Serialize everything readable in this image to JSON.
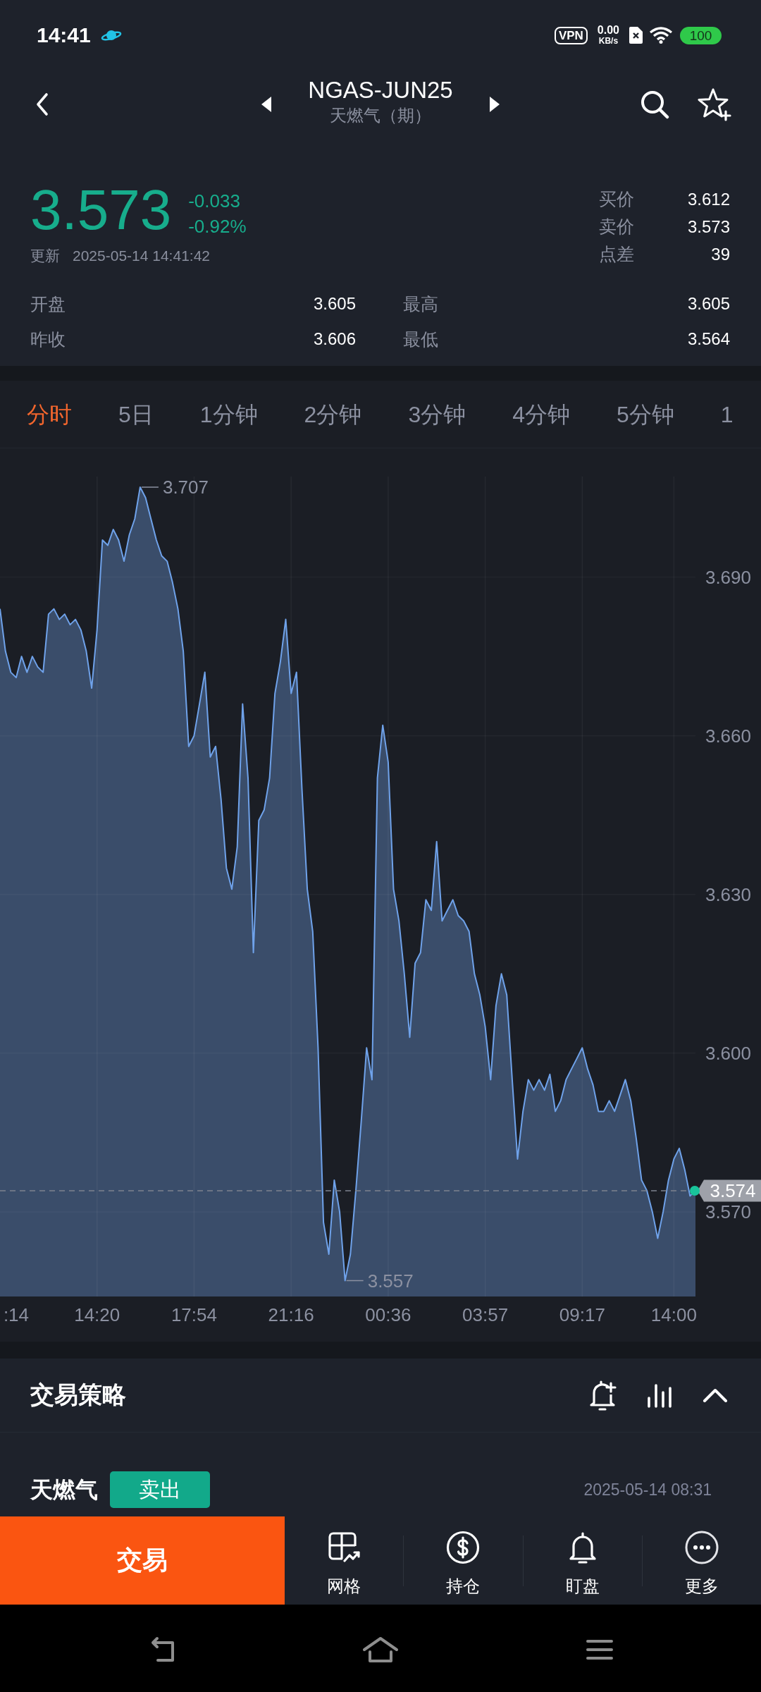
{
  "status_bar": {
    "time": "14:41",
    "vpn": "VPN",
    "net_speed": "0.00",
    "net_unit": "KB/s",
    "battery": "100"
  },
  "header": {
    "title": "NGAS-JUN25",
    "subtitle": "天燃气（期）"
  },
  "quote": {
    "price": "3.573",
    "change": "-0.033",
    "change_percent": "-0.92%",
    "down": true,
    "update_label": "更新",
    "update_time": "2025-05-14 14:41:42",
    "bid_ask": [
      {
        "label": "买价",
        "value": "3.612"
      },
      {
        "label": "卖价",
        "value": "3.573"
      },
      {
        "label": "点差",
        "value": "39"
      }
    ],
    "stats": [
      {
        "label": "开盘",
        "value": "3.605"
      },
      {
        "label": "最高",
        "value": "3.605"
      },
      {
        "label": "昨收",
        "value": "3.606"
      },
      {
        "label": "最低",
        "value": "3.564"
      }
    ]
  },
  "period_tabs": [
    {
      "label": "分时",
      "selected": true
    },
    {
      "label": "5日",
      "selected": false
    },
    {
      "label": "1分钟",
      "selected": false
    },
    {
      "label": "2分钟",
      "selected": false
    },
    {
      "label": "3分钟",
      "selected": false
    },
    {
      "label": "4分钟",
      "selected": false
    },
    {
      "label": "5分钟",
      "selected": false
    },
    {
      "label": "1",
      "selected": false
    }
  ],
  "chart": {
    "chart_data": {
      "type": "area",
      "categories": [
        null,
        null,
        null,
        ":14",
        null,
        null,
        null,
        null,
        null,
        null,
        null,
        null,
        null,
        null,
        null,
        null,
        null,
        null,
        "14:20",
        null,
        null,
        null,
        null,
        null,
        null,
        null,
        null,
        null,
        null,
        null,
        null,
        null,
        null,
        null,
        null,
        null,
        "17:54",
        null,
        null,
        null,
        null,
        null,
        null,
        null,
        null,
        null,
        null,
        null,
        null,
        null,
        null,
        null,
        null,
        null,
        "21:16",
        null,
        null,
        null,
        null,
        null,
        null,
        null,
        null,
        null,
        null,
        null,
        null,
        null,
        null,
        null,
        null,
        null,
        "00:36",
        null,
        null,
        null,
        null,
        null,
        null,
        null,
        null,
        null,
        null,
        null,
        null,
        null,
        null,
        null,
        null,
        null,
        "03:57",
        null,
        null,
        null,
        null,
        null,
        null,
        null,
        null,
        null,
        null,
        null,
        null,
        null,
        null,
        null,
        null,
        null,
        "09:17",
        null,
        null,
        null,
        null,
        null,
        null,
        null,
        null,
        null,
        null,
        null,
        null,
        null,
        null,
        null,
        null,
        "14:00",
        null,
        null,
        null,
        null
      ],
      "series": [
        {
          "color": "#6fa2ea",
          "values": [
            3.684,
            3.676,
            3.672,
            3.671,
            3.675,
            3.672,
            3.675,
            3.673,
            3.672,
            3.683,
            3.684,
            3.682,
            3.683,
            3.681,
            3.682,
            3.68,
            3.676,
            3.669,
            3.68,
            3.697,
            3.696,
            3.699,
            3.697,
            3.693,
            3.698,
            3.701,
            3.707,
            3.705,
            3.701,
            3.697,
            3.694,
            3.693,
            3.689,
            3.684,
            3.676,
            3.658,
            3.66,
            3.666,
            3.672,
            3.656,
            3.658,
            3.648,
            3.635,
            3.631,
            3.639,
            3.666,
            3.652,
            3.619,
            3.644,
            3.646,
            3.652,
            3.668,
            3.674,
            3.682,
            3.668,
            3.672,
            3.65,
            3.631,
            3.623,
            3.601,
            3.568,
            3.562,
            3.576,
            3.57,
            3.557,
            3.562,
            3.574,
            3.587,
            3.601,
            3.595,
            3.652,
            3.662,
            3.655,
            3.631,
            3.625,
            3.615,
            3.603,
            3.617,
            3.619,
            3.629,
            3.627,
            3.64,
            3.625,
            3.627,
            3.629,
            3.626,
            3.625,
            3.623,
            3.615,
            3.611,
            3.605,
            3.595,
            3.609,
            3.615,
            3.611,
            3.595,
            3.58,
            3.589,
            3.595,
            3.593,
            3.595,
            3.593,
            3.596,
            3.589,
            3.591,
            3.595,
            3.597,
            3.599,
            3.601,
            3.597,
            3.594,
            3.589,
            3.589,
            3.591,
            3.589,
            3.592,
            3.595,
            3.591,
            3.584,
            3.576,
            3.574,
            3.57,
            3.565,
            3.57,
            3.576,
            3.58,
            3.582,
            3.578,
            3.573,
            3.574
          ]
        }
      ],
      "ylim": [
        3.554,
        3.709
      ],
      "yticks": [
        {
          "value": 3.57,
          "label": "3.570"
        },
        {
          "value": 3.6,
          "label": "3.600"
        },
        {
          "value": 3.63,
          "label": "3.630"
        },
        {
          "value": 3.66,
          "label": "3.660"
        },
        {
          "value": 3.69,
          "label": "3.690"
        }
      ],
      "grid": true,
      "annotations": [
        "3.707",
        "3.557"
      ],
      "ref_lines": [
        {
          "axis": "y",
          "value": 3.574,
          "label": "3.574"
        }
      ]
    }
  },
  "strategy": {
    "title": "交易策略",
    "signal": {
      "name": "天燃气",
      "sell": true,
      "action": "卖出",
      "time": "2025-05-14 08:31"
    }
  },
  "bottom_nav": {
    "trade_button": "交易",
    "items": [
      {
        "label": "网格"
      },
      {
        "label": "持仓"
      },
      {
        "label": "盯盘"
      },
      {
        "label": "更多"
      }
    ]
  }
}
